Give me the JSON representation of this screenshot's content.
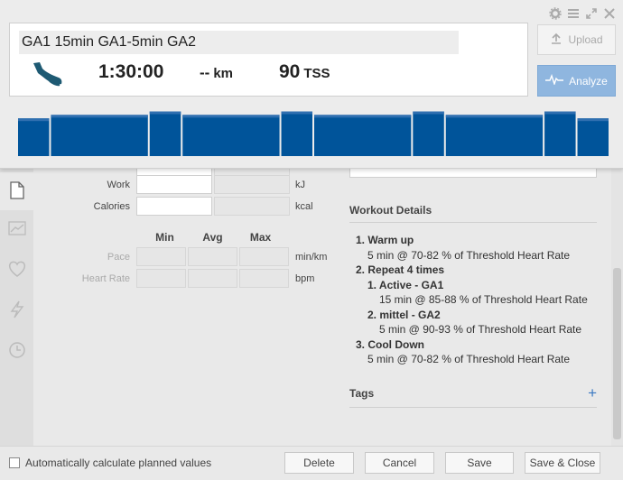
{
  "header": {
    "title": "GA1 15min GA1-5min GA2",
    "duration": "1:30:00",
    "distance_value": "--",
    "distance_unit": "km",
    "tss_value": "90",
    "tss_unit": "TSS",
    "upload_label": "Upload",
    "analyze_label": "Analyze"
  },
  "intensity_bars": [
    {
      "value": 0.76
    },
    {
      "value": 0.83
    },
    {
      "value": 0.9
    },
    {
      "value": 0.83
    },
    {
      "value": 0.9
    },
    {
      "value": 0.83
    },
    {
      "value": 0.9
    },
    {
      "value": 0.83
    },
    {
      "value": 0.9
    },
    {
      "value": 0.76
    }
  ],
  "form": {
    "work_label": "Work",
    "work_unit": "kJ",
    "calories_label": "Calories",
    "calories_unit": "kcal",
    "col_min": "Min",
    "col_avg": "Avg",
    "col_max": "Max",
    "pace_label": "Pace",
    "pace_unit": "min/km",
    "hr_label": "Heart Rate",
    "hr_unit": "bpm"
  },
  "details": {
    "header": "Workout Details",
    "steps": [
      {
        "num": "1.",
        "title": "Warm up",
        "desc": "5 min @ 70-82 % of Threshold Heart Rate"
      },
      {
        "num": "2.",
        "title": "Repeat 4 times"
      },
      {
        "num": "1.",
        "title": "Active - GA1",
        "desc": "15 min @ 85-88 % of Threshold Heart Rate"
      },
      {
        "num": "2.",
        "title": "mittel - GA2",
        "desc": "5 min @ 90-93 % of Threshold Heart Rate"
      },
      {
        "num": "3.",
        "title": "Cool Down",
        "desc": "5 min @ 70-82 % of Threshold Heart Rate"
      }
    ],
    "tags_label": "Tags",
    "tags_add": "+"
  },
  "footer": {
    "auto_calc_label": "Automatically calculate planned values",
    "delete_label": "Delete",
    "cancel_label": "Cancel",
    "save_label": "Save",
    "save_close_label": "Save & Close"
  },
  "colors": {
    "bar_fill": "#00549a",
    "bar_top": "#2f6fb0",
    "analyze_bg": "#8fb6df",
    "accent": "#3a79c2"
  }
}
